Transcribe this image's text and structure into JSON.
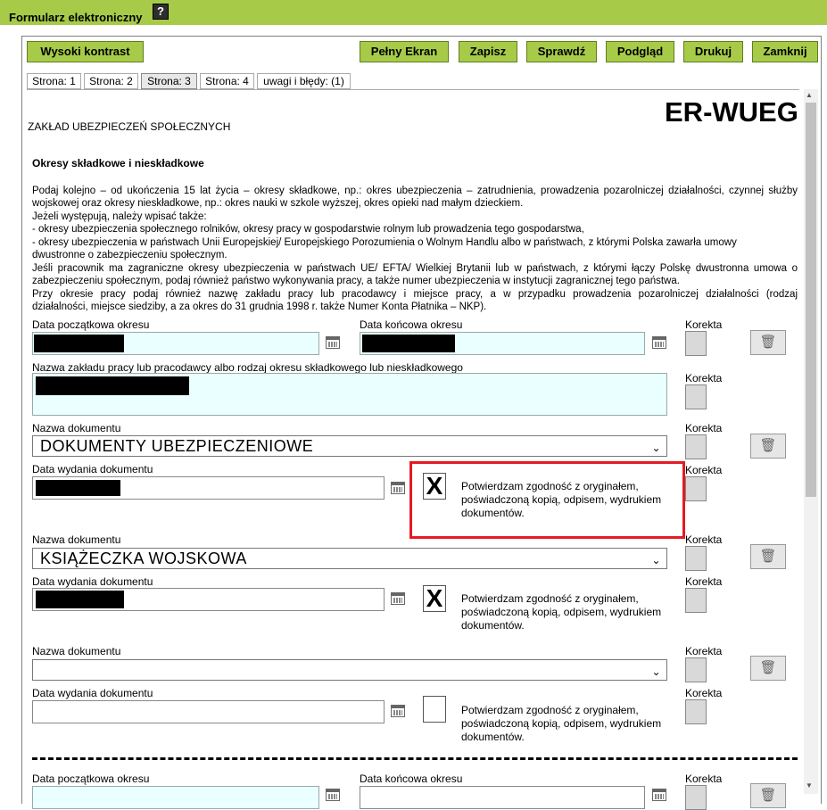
{
  "app": {
    "title": "Formularz elektroniczny",
    "help": "?"
  },
  "toolbar": {
    "high_contrast": "Wysoki kontrast",
    "fullscreen": "Pełny Ekran",
    "save": "Zapisz",
    "check": "Sprawdź",
    "preview": "Podgląd",
    "print": "Drukuj",
    "close": "Zamknij"
  },
  "tabs": [
    "Strona: 1",
    "Strona: 2",
    "Strona: 3",
    "Strona: 4",
    "uwagi i błędy: (1)"
  ],
  "active_tab": "Strona: 3",
  "form": {
    "code": "ER-WUEG",
    "institution": "ZAKŁAD UBEZPIECZEŃ SPOŁECZNYCH",
    "section_title": "Okresy składkowe i nieskładkowe",
    "instructions": [
      "Podaj kolejno – od ukończenia 15 lat życia – okresy składkowe, np.: okres ubezpieczenia – zatrudnienia, prowadzenia pozarolniczej działalności, czynnej służby",
      "wojskowej oraz okresy nieskładkowe, np.: okres nauki w szkole wyższej, okres opieki nad małym dzieckiem.",
      "Jeżeli występują, należy wpisać także:",
      "- okresy ubezpieczenia społecznego rolników, okresy pracy w gospodarstwie rolnym lub prowadzenia tego gospodarstwa,",
      "- okresy ubezpieczenia w państwach Unii Europejskiej/ Europejskiego Porozumienia o Wolnym Handlu albo w państwach, z którymi Polska zawarła umowy",
      "dwustronne o zabezpieczeniu społecznym.",
      "Jeśli pracownik ma zagraniczne okresy ubezpieczenia w państwach UE/ EFTA/ Wielkiej Brytanii lub w państwach, z którymi łączy Polskę dwustronna umowa o",
      "zabezpieczeniu społecznym, podaj również państwo wykonywania pracy, a także numer ubezpieczenia w instytucji zagranicznej tego państwa.",
      "Przy okresie pracy podaj również nazwę zakładu pracy lub pracodawcy i miejsce pracy, a w przypadku prowadzenia pozarolniczej działalności (rodzaj",
      "działalności, miejsce siedziby, a za okres do 31 grudnia 1998 r. także Numer Konta Płatnika – NKP)."
    ],
    "labels": {
      "start_date": "Data początkowa okresu",
      "end_date": "Data końcowa okresu",
      "correction": "Korekta",
      "employer_name": "Nazwa zakładu pracy lub pracodawcy albo rodzaj okresu składkowego lub nieskładkowego",
      "document_name": "Nazwa dokumentu",
      "issue_date": "Data wydania dokumentu",
      "confirm": "Potwierdzam zgodność z oryginałem, poświadczoną kopią, odpisem, wydrukiem dokumentów."
    },
    "documents": [
      {
        "name": "DOKUMENTY UBEZPIECZENIOWE",
        "confirmed": "X"
      },
      {
        "name": "KSIĄŻECZKA WOJSKOWA",
        "confirmed": "X"
      },
      {
        "name": "",
        "confirmed": ""
      }
    ]
  },
  "colors": {
    "accent": "#a7cb49",
    "highlight": "#e41b23",
    "field_bg": "#eaffff"
  },
  "icons": {
    "calendar": "calendar-icon",
    "trash": "trash-icon",
    "help": "help-icon"
  }
}
